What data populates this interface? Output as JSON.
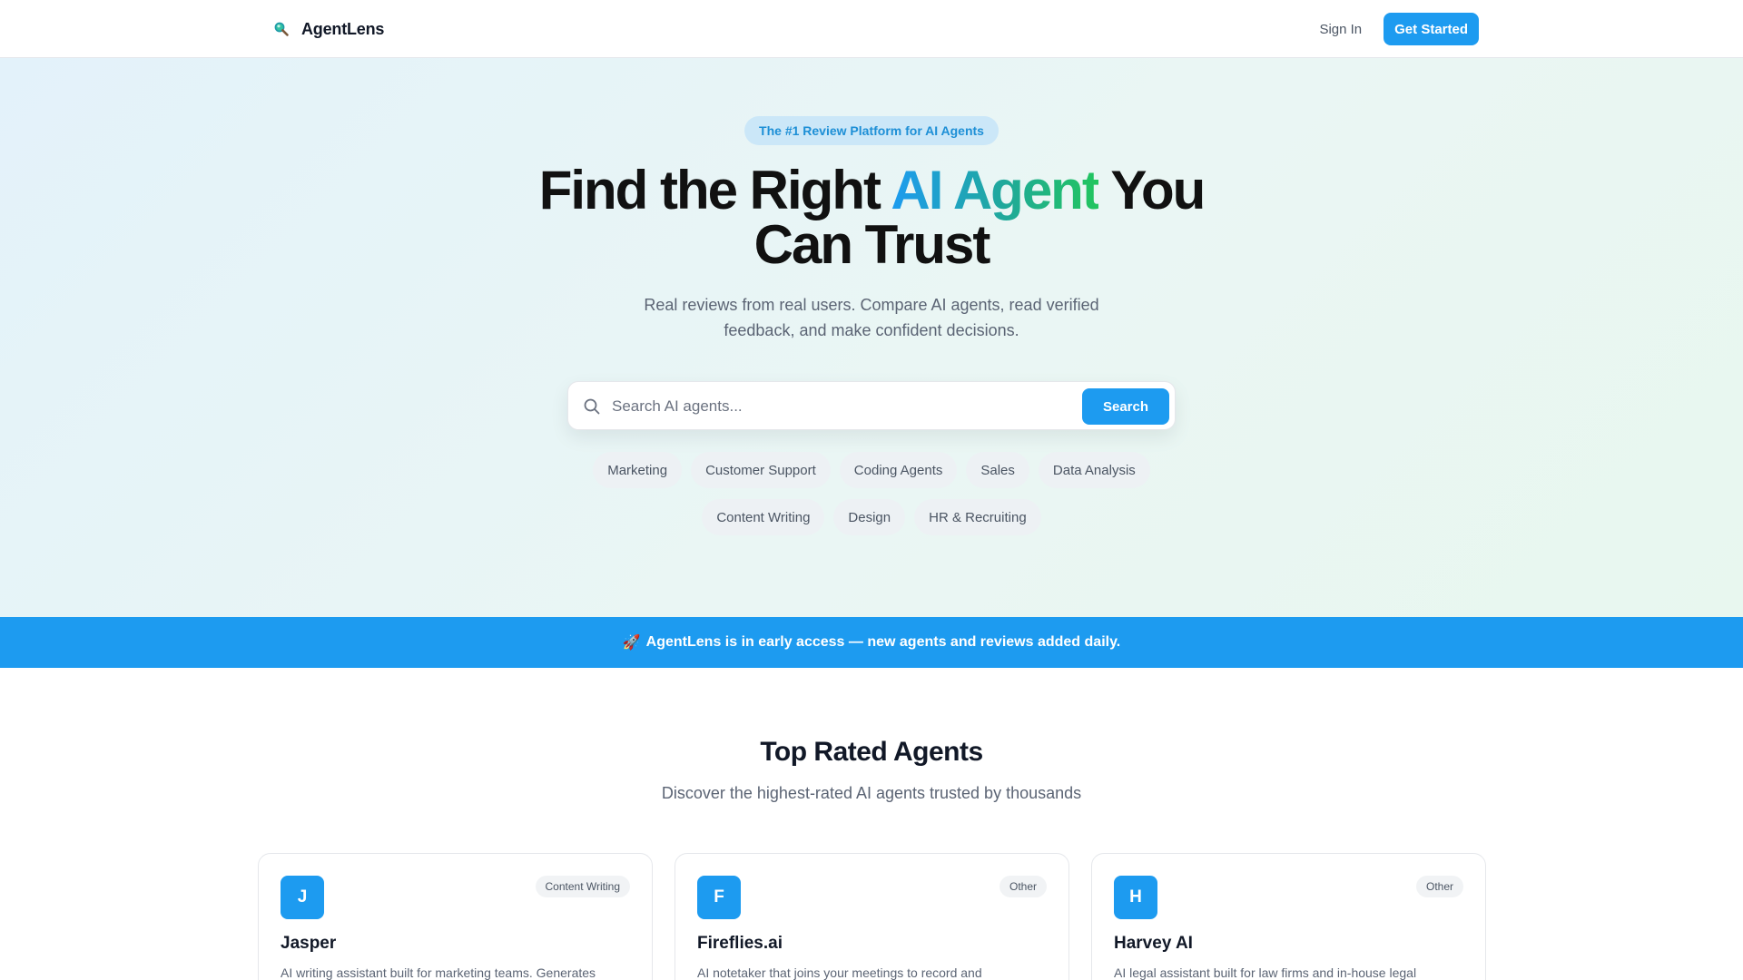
{
  "nav": {
    "brand_name": "AgentLens",
    "brand_icon": "magnifier-icon",
    "sign_in": "Sign In",
    "get_started": "Get Started"
  },
  "hero": {
    "badge": "The #1 Review Platform for AI Agents",
    "title_before": "Find the Right ",
    "title_highlight": "AI Agent",
    "title_after": " You",
    "title_line2": "Can Trust",
    "subtitle": "Real reviews from real users. Compare AI agents, read verified feedback, and make confident decisions.",
    "search_placeholder": "Search AI agents...",
    "search_button": "Search",
    "categories": [
      "Marketing",
      "Customer Support",
      "Coding Agents",
      "Sales",
      "Data Analysis",
      "Content Writing",
      "Design",
      "HR & Recruiting"
    ]
  },
  "banner": {
    "emoji": "🚀",
    "text": "AgentLens is in early access — new agents and reviews added daily."
  },
  "top_rated": {
    "title": "Top Rated Agents",
    "subtitle": "Discover the highest-rated AI agents trusted by thousands",
    "cards": [
      {
        "initial": "J",
        "name": "Jasper",
        "category": "Content Writing",
        "description": "AI writing assistant built for marketing teams. Generates"
      },
      {
        "initial": "F",
        "name": "Fireflies.ai",
        "category": "Other",
        "description": "AI notetaker that joins your meetings to record and"
      },
      {
        "initial": "H",
        "name": "Harvey AI",
        "category": "Other",
        "description": "AI legal assistant built for law firms and in-house legal"
      }
    ]
  },
  "colors": {
    "accent": "#1d9bf0",
    "gradient_start": "#1d9bf0",
    "gradient_end": "#22c55e"
  }
}
